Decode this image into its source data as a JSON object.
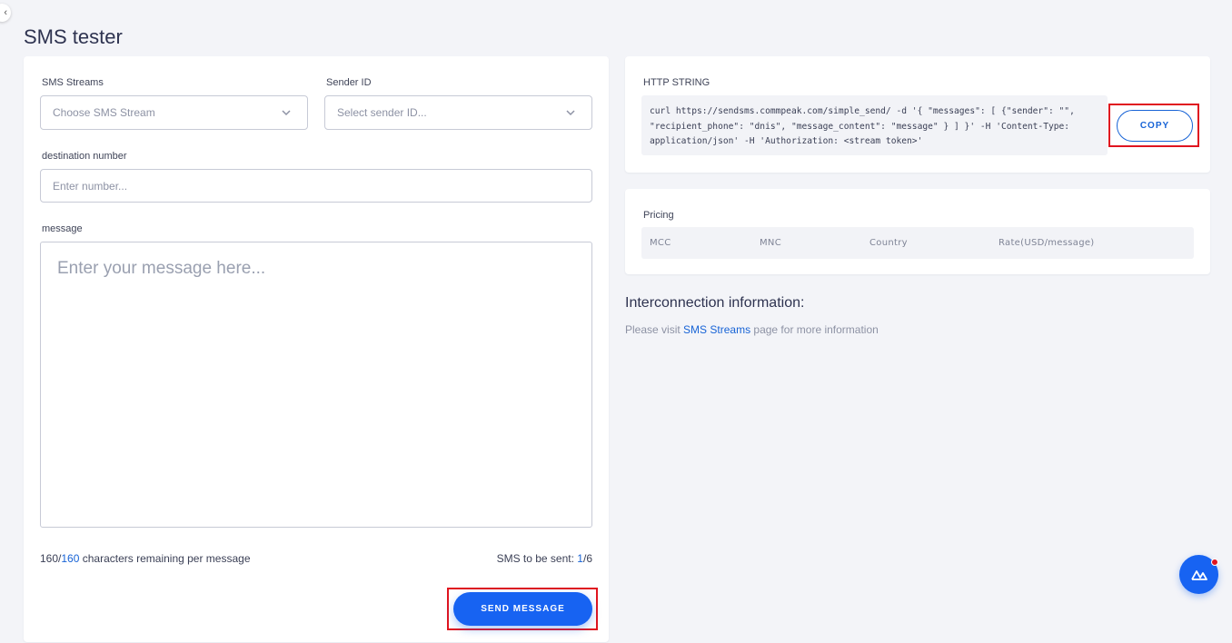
{
  "page": {
    "title": "SMS tester"
  },
  "form": {
    "streams_label": "SMS Streams",
    "streams_placeholder": "Choose SMS Stream",
    "sender_label": "Sender ID",
    "sender_placeholder": "Select sender ID...",
    "destination_label": "destination number",
    "destination_placeholder": "Enter number...",
    "message_label": "message",
    "message_placeholder": "Enter your message here...",
    "chars_remaining": "160",
    "chars_total": "160",
    "chars_suffix": "characters remaining per message",
    "sms_sent_label": "SMS to be sent:",
    "sms_sent_current": "1",
    "sms_sent_total": "/6",
    "send_label": "SEND MESSAGE"
  },
  "http": {
    "title": "HTTP STRING",
    "curl": "curl https://sendsms.commpeak.com/simple_send/ -d '{ \"messages\": [ {\"sender\": \"\", \"recipient_phone\": \"dnis\", \"message_content\": \"message\" } ] }' -H 'Content-Type: application/json' -H 'Authorization: <stream token>'",
    "copy_label": "COPY"
  },
  "pricing": {
    "title": "Pricing",
    "columns": [
      "MCC",
      "MNC",
      "Country",
      "Rate(USD/message)"
    ]
  },
  "interconnect": {
    "title": "Interconnection information:",
    "text_before": "Please visit",
    "link": "SMS Streams",
    "text_after": "page for more information"
  },
  "colors": {
    "accent": "#1763f2",
    "highlight": "#e0141f",
    "background": "#f3f4f8"
  },
  "icons": {
    "select_chevron": "chevron-down-icon",
    "chat": "chat-logo-icon",
    "collapse": "chevron-left-icon"
  }
}
